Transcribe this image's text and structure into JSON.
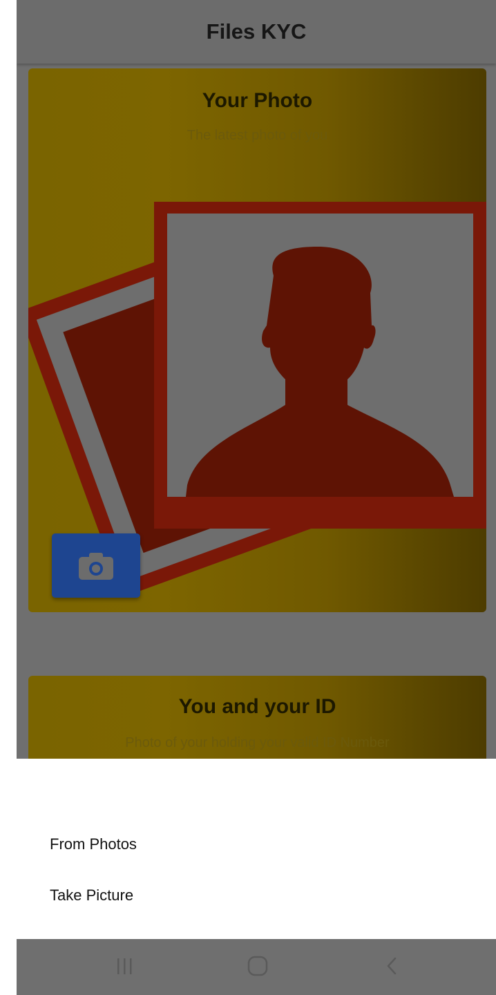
{
  "app_bar": {
    "title": "Files KYC"
  },
  "cards": {
    "photo": {
      "title": "Your Photo",
      "subtitle": "The latest photo of you",
      "camera_icon": "camera-icon"
    },
    "id": {
      "title": "You and your ID",
      "subtitle": "Photo of your holding your valid ID Number"
    }
  },
  "picker_sheet": {
    "option_photos": "From Photos",
    "option_camera": "Take Picture"
  },
  "system_nav": {
    "recents_icon": "recents-icon",
    "home_icon": "home-icon",
    "back_icon": "back-icon"
  },
  "colors": {
    "card_yellow": "#7d6500",
    "frame_red": "#7a1808",
    "camera_button": "#1e4590",
    "scrim": "#6f6f6f"
  }
}
